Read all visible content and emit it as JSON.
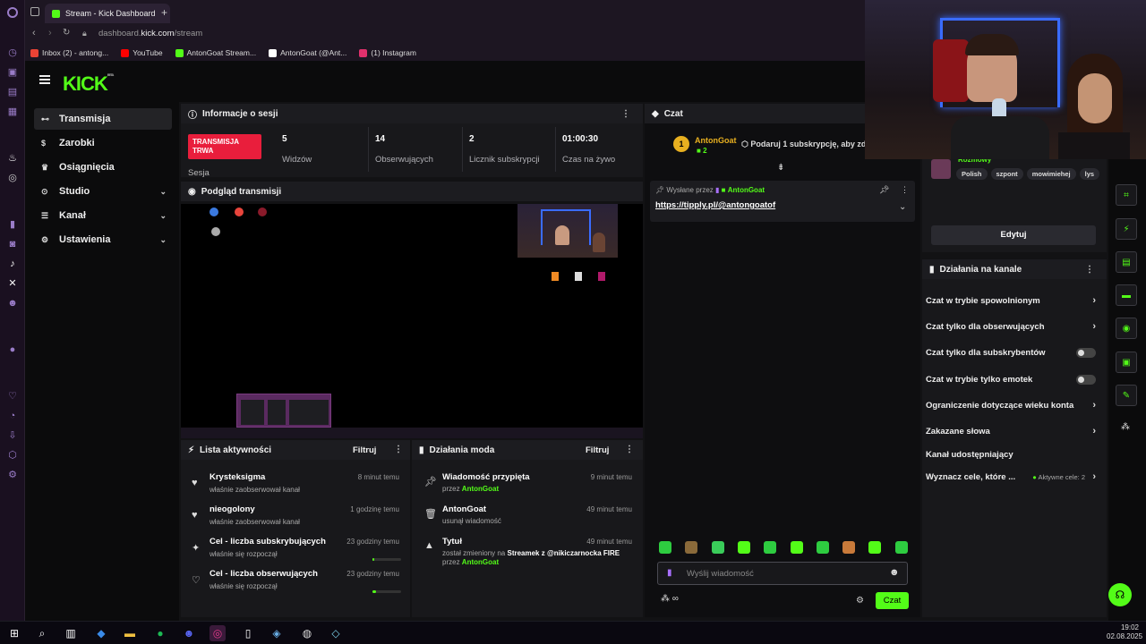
{
  "browser": {
    "tab_title": "Stream - Kick Dashboard",
    "url_host": "dashboard.",
    "url_domain": "kick.com",
    "url_path": "/stream",
    "bookmarks": [
      {
        "label": "Inbox (2) - antong...",
        "color": "#ea4335"
      },
      {
        "label": "YouTube",
        "color": "#ff0000"
      },
      {
        "label": "AntonGoat Stream...",
        "color": "#53fc18"
      },
      {
        "label": "AntonGoat (@Ant...",
        "color": "#ffffff"
      },
      {
        "label": "(1) Instagram",
        "color": "#e1306c"
      }
    ]
  },
  "app": {
    "logo": "KICK",
    "logo_badge": "BETA",
    "accent": "#53fc18"
  },
  "sidebar": {
    "items": [
      {
        "label": "Transmisja",
        "icon": "live-icon"
      },
      {
        "label": "Zarobki",
        "icon": "money-icon"
      },
      {
        "label": "Osiągnięcia",
        "icon": "trophy-icon"
      },
      {
        "label": "Studio",
        "icon": "studio-icon"
      },
      {
        "label": "Kanał",
        "icon": "channel-icon"
      },
      {
        "label": "Ustawienia",
        "icon": "gear-icon"
      }
    ]
  },
  "session": {
    "title": "Informacje o sesji",
    "live_badge_line1": "TRANSMISJA",
    "live_badge_line2": "TRWA",
    "live_label": "Sesja",
    "stats": [
      {
        "value": "5",
        "label": "Widzów"
      },
      {
        "value": "14",
        "label": "Obserwujących"
      },
      {
        "value": "2",
        "label": "Licznik subskrypcji"
      },
      {
        "value": "01:00:30",
        "label": "Czas na żywo"
      }
    ]
  },
  "preview": {
    "title": "Podgląd transmisji"
  },
  "activity": {
    "title": "Lista aktywności",
    "filter": "Filtruj",
    "rows": [
      {
        "name": "Krysteksigma",
        "desc": "właśnie zaobserwował kanał",
        "time": "8 minut temu",
        "icon": "heart-icon"
      },
      {
        "name": "nieogolony",
        "desc": "właśnie zaobserwował kanał",
        "time": "1 godzinę temu",
        "icon": "heart-icon"
      },
      {
        "name": "Cel - liczba subskrybujących",
        "desc": "właśnie się rozpoczął",
        "time": "23 godziny temu",
        "icon": "sparkle-icon"
      },
      {
        "name": "Cel - liczba obserwujących",
        "desc": "właśnie się rozpoczął",
        "time": "23 godziny temu",
        "icon": "heart-outline-icon"
      }
    ]
  },
  "mod": {
    "title": "Działania moda",
    "filter": "Filtruj",
    "rows": [
      {
        "name": "Wiadomość przypięta",
        "desc_prefix": "przez ",
        "desc_user": "AntonGoat",
        "time": "9 minut temu",
        "icon": "pin-icon"
      },
      {
        "name": "AntonGoat",
        "desc_prefix": "usunął wiadomość",
        "desc_user": "",
        "time": "49 minut temu",
        "icon": "trash-icon"
      },
      {
        "name": "Tytuł",
        "desc_prefix": "został zmieniony na ",
        "desc_bold": "Streamek z @nikiczarnocka FIRE",
        "desc_line2_prefix": "przez ",
        "desc_user": "AntonGoat",
        "time": "49 minut temu",
        "icon": "user-icon"
      }
    ]
  },
  "chat": {
    "title": "Czat",
    "gift_user": "AntonGoat",
    "gift_count": "2",
    "gift_rank": "1",
    "gift_text": "Podaruj 1 subskrypcję, aby zd",
    "pinned_by_label": "Wysłane przez",
    "pinned_user": "AntonGoat",
    "pinned_link": "https://tipply.pl/@antongoatof",
    "input_placeholder": "Wyślij wiadomość",
    "send_label": "Czat",
    "infinity": "∞"
  },
  "viewer_card": {
    "name_partial": "Rozmowy",
    "tags": [
      "Polish",
      "szpont",
      "mowimiehej",
      "lys"
    ],
    "edit_label": "Edytuj"
  },
  "channel_actions": {
    "title": "Działania na kanale",
    "rows": [
      {
        "label": "Czat w trybie spowolnionym",
        "control": "arrow"
      },
      {
        "label": "Czat tylko dla obserwujących",
        "control": "arrow"
      },
      {
        "label": "Czat tylko dla subskrybentów",
        "control": "toggle"
      },
      {
        "label": "Czat w trybie tylko emotek",
        "control": "toggle"
      },
      {
        "label": "Ograniczenie dotyczące wieku konta",
        "control": "arrow"
      },
      {
        "label": "Zakazane słowa",
        "control": "arrow"
      },
      {
        "label": "Kanał udostępniający",
        "control": "none"
      },
      {
        "label": "Wyznacz cele, które ...",
        "control": "arrow",
        "extra": "Aktywne cele: 2"
      }
    ]
  },
  "taskbar": {
    "time": "19:02",
    "date": "02.08.2025"
  }
}
